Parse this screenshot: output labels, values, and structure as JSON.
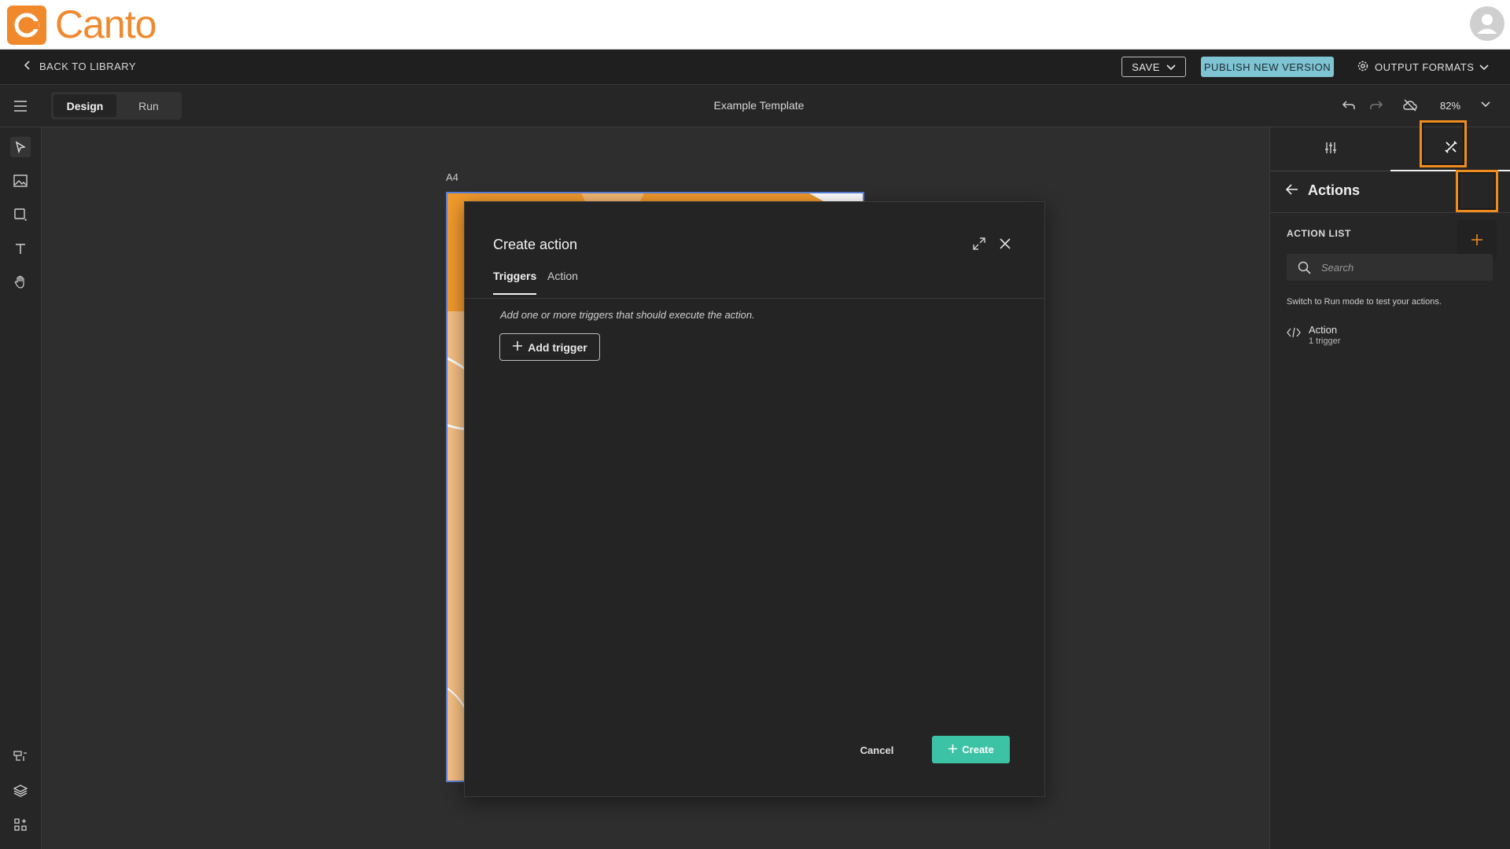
{
  "brand": {
    "name": "Canto",
    "color": "#f0892c"
  },
  "topbar": {
    "back_label": "BACK TO LIBRARY",
    "save_label": "SAVE",
    "publish_label": "PUBLISH NEW VERSION",
    "output_formats_label": "OUTPUT FORMATS"
  },
  "editor": {
    "mode_tabs": [
      {
        "label": "Design",
        "active": true
      },
      {
        "label": "Run",
        "active": false
      }
    ],
    "document_title": "Example Template",
    "zoom": "82%"
  },
  "left_rail": {
    "tools": [
      "select-icon",
      "image-icon",
      "shape-icon",
      "text-icon",
      "hand-icon"
    ],
    "bottom": [
      "variables-icon",
      "layers-icon",
      "components-icon"
    ]
  },
  "canvas": {
    "page_label": "A4",
    "page_color": "#f6c083"
  },
  "right_panel": {
    "tabs": [
      "properties-icon",
      "actions-icon"
    ],
    "header": "Actions",
    "list_label": "ACTION LIST",
    "search_placeholder": "Search",
    "hint": "Switch to Run mode to test your actions.",
    "actions": [
      {
        "name": "Action",
        "sub": "1 trigger"
      }
    ]
  },
  "modal": {
    "title": "Create action",
    "tabs": [
      {
        "label": "Triggers",
        "active": true
      },
      {
        "label": "Action",
        "active": false
      }
    ],
    "hint": "Add one or more triggers that should execute the action.",
    "add_trigger_label": "Add trigger",
    "cancel_label": "Cancel",
    "create_label": "Create",
    "create_color": "#3cc3a5"
  },
  "highlight_color": "#f08c1e"
}
